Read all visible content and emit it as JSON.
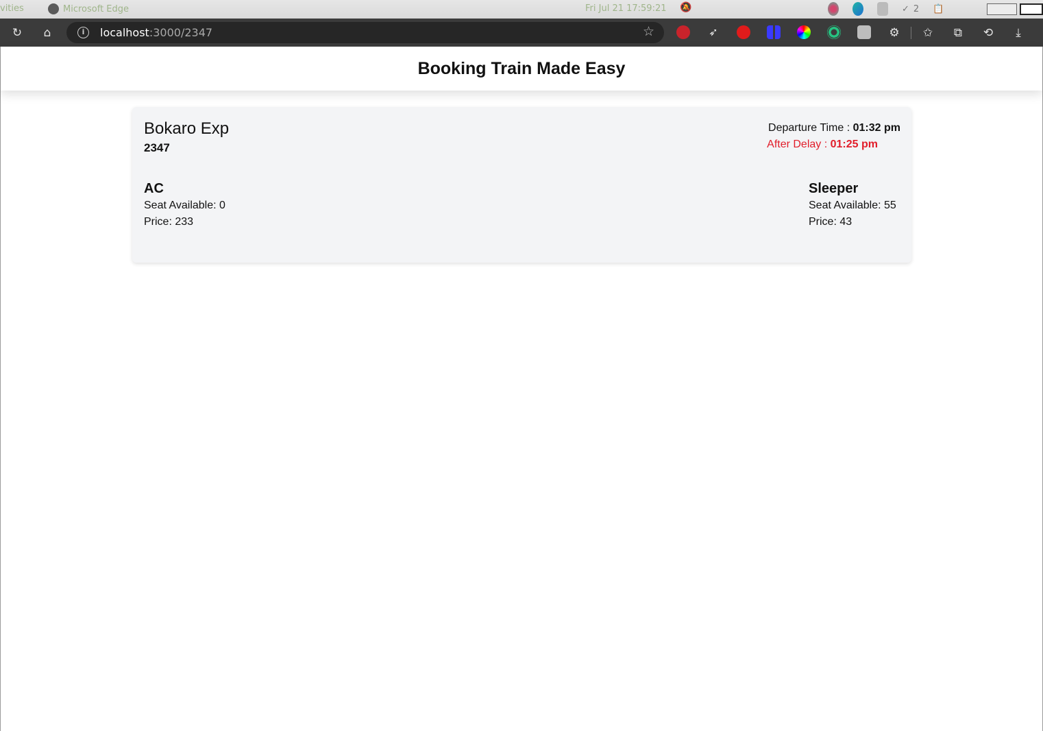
{
  "os_bar": {
    "activities": "vities",
    "app_name": "Microsoft Edge",
    "clock": "Fri Jul 21  17:59:21",
    "tray_count": "2"
  },
  "browser": {
    "url_host": "localhost",
    "url_path": ":3000/2347",
    "extensions": [
      "puzzle-red-icon",
      "bird-icon",
      "hand-red-icon",
      "blue-panel-icon",
      "color-wheel-icon",
      "green-circle-icon",
      "grey-square-icon"
    ],
    "colors": {
      "toolbar_bg": "#3b3b3b",
      "address_bg": "#262626"
    }
  },
  "page": {
    "title": "Booking Train Made Easy",
    "train": {
      "name": "Bokaro Exp",
      "number": "2347",
      "departure_label": "Departure Time : ",
      "departure_time": "01:32 pm",
      "delay_label": "After Delay : ",
      "delay_time": "01:25 pm",
      "delay_color": "#e11d2a"
    },
    "classes": [
      {
        "title": "AC",
        "seats": "Seat Available: 0",
        "price": "Price: 233"
      },
      {
        "title": "Sleeper",
        "seats": "Seat Available: 55",
        "price": "Price: 43"
      }
    ]
  }
}
